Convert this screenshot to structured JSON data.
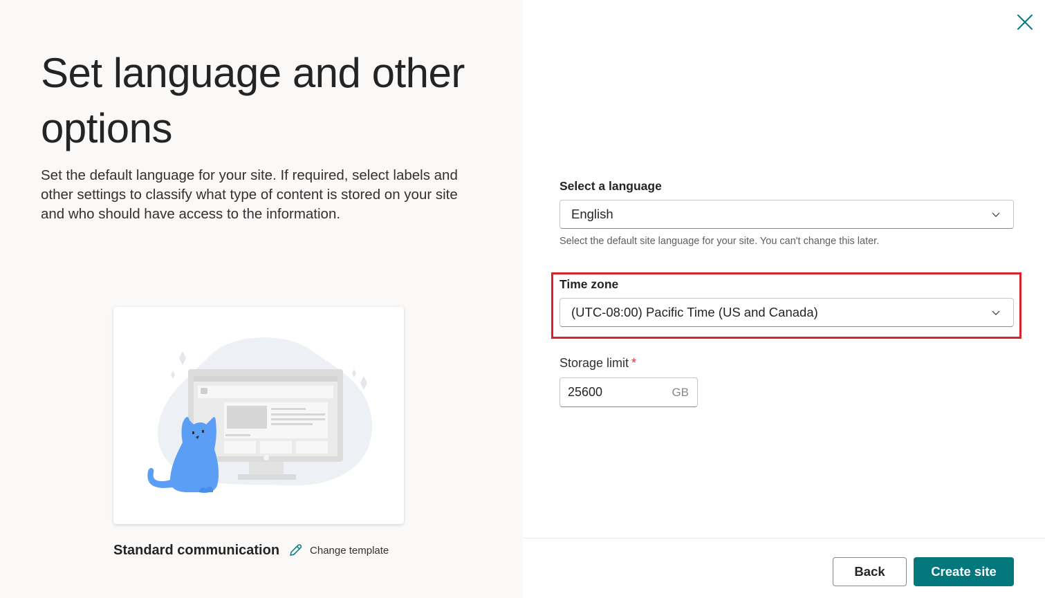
{
  "page": {
    "title": "Set language and other options",
    "description": "Set the default language for your site. If required, select labels and other settings to classify what type of content is stored on your site and who should have access to the information."
  },
  "template": {
    "name": "Standard communication",
    "change_label": "Change template",
    "illustration_icon": "cat-with-monitor-illustration"
  },
  "form": {
    "language": {
      "label": "Select a language",
      "value": "English",
      "help": "Select the default site language for your site. You can't change this later."
    },
    "timezone": {
      "label": "Time zone",
      "value": "(UTC-08:00) Pacific Time (US and Canada)"
    },
    "storage": {
      "label": "Storage limit",
      "required_mark": "*",
      "value": "25600",
      "unit": "GB"
    }
  },
  "footer": {
    "back_label": "Back",
    "create_label": "Create site"
  },
  "colors": {
    "accent": "#03787c",
    "highlight_border": "#d8222e",
    "left_panel_bg": "#faf9f8",
    "cat": "#5a9ef5"
  },
  "icons": {
    "close": "close-icon",
    "chevron": "chevron-down-icon",
    "edit": "pencil-icon"
  }
}
